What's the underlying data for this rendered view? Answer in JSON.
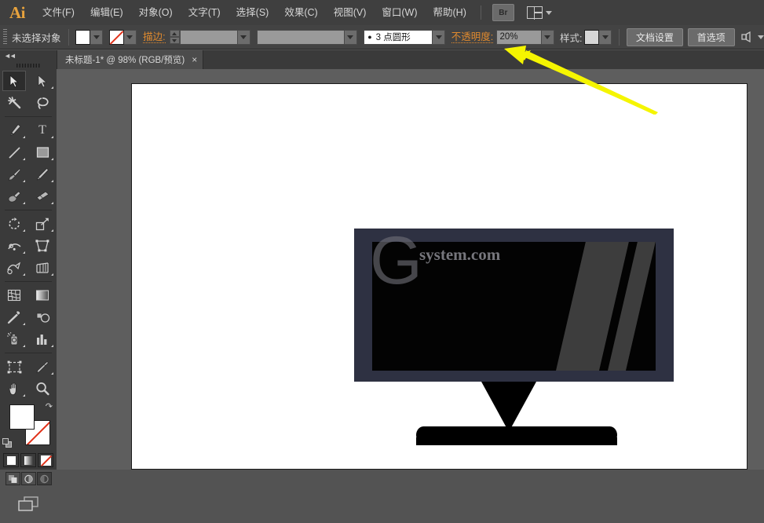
{
  "app": {
    "name": "Adobe Illustrator",
    "logo_text": "Ai",
    "logo_color": "#e8a33d"
  },
  "menubar": {
    "items": [
      {
        "label": "文件(F)",
        "name": "menu-file"
      },
      {
        "label": "编辑(E)",
        "name": "menu-edit"
      },
      {
        "label": "对象(O)",
        "name": "menu-object"
      },
      {
        "label": "文字(T)",
        "name": "menu-type"
      },
      {
        "label": "选择(S)",
        "name": "menu-select"
      },
      {
        "label": "效果(C)",
        "name": "menu-effect"
      },
      {
        "label": "视图(V)",
        "name": "menu-view"
      },
      {
        "label": "窗口(W)",
        "name": "menu-window"
      },
      {
        "label": "帮助(H)",
        "name": "menu-help"
      }
    ],
    "bridge_label": "Br",
    "arrange_icon": "arrange-documents-icon"
  },
  "controlbar": {
    "selection_status": "未选择对象",
    "fill_swatch": "#ffffff",
    "stroke_swatch": "none",
    "stroke_label": "描边:",
    "stroke_weight_value": "",
    "stroke_profile_value": "",
    "brush_definition": "3 点圆形",
    "opacity_label": "不透明度:",
    "opacity_value": "20%",
    "style_label": "样式:",
    "style_swatch": "#ffffff",
    "document_setup_button": "文档设置",
    "preferences_button": "首选项"
  },
  "tabbar": {
    "document_tab": "未标题-1* @ 98% (RGB/预览)",
    "close_glyph": "×"
  },
  "toolpanel": {
    "collapse_icon": "double-chevron-left-icon",
    "tools": [
      {
        "name": "selection-tool",
        "glyph": "↖",
        "selected": true,
        "corner": false
      },
      {
        "name": "direct-selection-tool",
        "glyph": "↖",
        "selected": false,
        "corner": true
      },
      {
        "name": "magic-wand-tool",
        "glyph": "✦",
        "selected": false,
        "corner": false
      },
      {
        "name": "lasso-tool",
        "glyph": "⥁",
        "selected": false,
        "corner": false
      },
      {
        "name": "pen-tool",
        "glyph": "✒",
        "selected": false,
        "corner": true
      },
      {
        "name": "type-tool",
        "glyph": "T",
        "selected": false,
        "corner": true
      },
      {
        "name": "line-segment-tool",
        "glyph": "╱",
        "selected": false,
        "corner": true
      },
      {
        "name": "rectangle-tool",
        "glyph": "■",
        "selected": false,
        "corner": true
      },
      {
        "name": "paintbrush-tool",
        "glyph": "✎",
        "selected": false,
        "corner": true
      },
      {
        "name": "pencil-tool",
        "glyph": "✏",
        "selected": false,
        "corner": true
      },
      {
        "name": "blob-brush-tool",
        "glyph": "◠",
        "selected": false,
        "corner": true
      },
      {
        "name": "eraser-tool",
        "glyph": "▱",
        "selected": false,
        "corner": true
      },
      {
        "name": "rotate-tool",
        "glyph": "↺",
        "selected": false,
        "corner": true
      },
      {
        "name": "scale-tool",
        "glyph": "⤡",
        "selected": false,
        "corner": true
      },
      {
        "name": "width-tool",
        "glyph": "❀",
        "selected": false,
        "corner": true
      },
      {
        "name": "free-transform-tool",
        "glyph": "▣",
        "selected": false,
        "corner": false
      },
      {
        "name": "shape-builder-tool",
        "glyph": "◔",
        "selected": false,
        "corner": true
      },
      {
        "name": "perspective-grid-tool",
        "glyph": "⬟",
        "selected": false,
        "corner": true
      },
      {
        "name": "mesh-tool",
        "glyph": "⌗",
        "selected": false,
        "corner": false
      },
      {
        "name": "gradient-tool",
        "glyph": "▤",
        "selected": false,
        "corner": false
      },
      {
        "name": "eyedropper-tool",
        "glyph": "⚗",
        "selected": false,
        "corner": true
      },
      {
        "name": "blend-tool",
        "glyph": "◎",
        "selected": false,
        "corner": false
      },
      {
        "name": "symbol-sprayer-tool",
        "glyph": "☂",
        "selected": false,
        "corner": true
      },
      {
        "name": "column-graph-tool",
        "glyph": "█",
        "selected": false,
        "corner": true
      },
      {
        "name": "artboard-tool",
        "glyph": "⬚",
        "selected": false,
        "corner": false
      },
      {
        "name": "slice-tool",
        "glyph": "✂",
        "selected": false,
        "corner": true
      },
      {
        "name": "hand-tool",
        "glyph": "✋",
        "selected": false,
        "corner": true
      },
      {
        "name": "zoom-tool",
        "glyph": "⌕",
        "selected": false,
        "corner": false
      }
    ],
    "fill_stroke": {
      "fill_color": "#ffffff",
      "stroke_color": "none",
      "swap_icon": "swap-fill-stroke-icon",
      "default_icon": "default-fill-stroke-icon"
    },
    "paint_modes": [
      {
        "name": "color-mode-button",
        "label": "solid"
      },
      {
        "name": "gradient-mode-button",
        "label": "gradient"
      },
      {
        "name": "none-mode-button",
        "label": "none"
      }
    ],
    "draw_modes": [
      {
        "name": "draw-normal-button",
        "glyph": "◔",
        "active": true
      },
      {
        "name": "draw-behind-button",
        "glyph": "◑",
        "active": true
      },
      {
        "name": "draw-inside-button",
        "glyph": "◕",
        "active": false
      }
    ],
    "screen_mode": {
      "name": "change-screen-mode-button",
      "glyph": "❐"
    }
  },
  "canvas": {
    "background_color": "#5e5e5e",
    "artboard_color": "#ffffff",
    "zoom_level": "98%",
    "artwork": {
      "name": "monitor-illustration",
      "bezel_color": "#2e3142",
      "screen_color": "#030303",
      "glare_color": "#3d3d3d",
      "stand_color": "#000000"
    },
    "watermark": {
      "logo_letter": "G",
      "text": "system.com"
    },
    "annotation": {
      "name": "yellow-arrow-annotation",
      "color": "#f5f500",
      "points_to": "opacity-field"
    }
  }
}
